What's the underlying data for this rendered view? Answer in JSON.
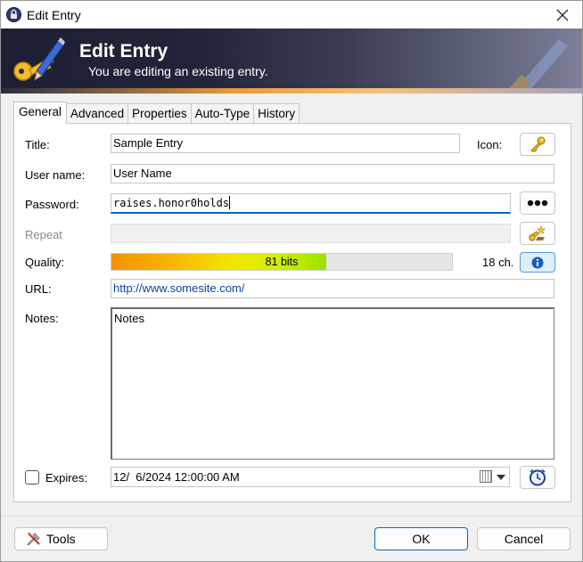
{
  "window": {
    "title": "Edit Entry",
    "close_label": "Close"
  },
  "banner": {
    "title": "Edit Entry",
    "subtitle": "You are editing an existing entry."
  },
  "tabs": [
    "General",
    "Advanced",
    "Properties",
    "Auto-Type",
    "History"
  ],
  "active_tab": "General",
  "form": {
    "title_label": "Title:",
    "title_value": "Sample Entry",
    "icon_label": "Icon:",
    "username_label": "User name:",
    "username_value": "User Name",
    "password_label": "Password:",
    "password_value": "raises.honor0holds",
    "repeat_label": "Repeat",
    "quality_label": "Quality:",
    "quality_text": "81 bits",
    "quality_fraction": 0.63,
    "quality_length": "18 ch.",
    "url_label": "URL:",
    "url_value": "http://www.somesite.com/",
    "notes_label": "Notes:",
    "notes_value": "Notes",
    "expires_label": "Expires:",
    "expires_checked": false,
    "expires_value": "12/  6/2024 12:00:00 AM"
  },
  "footer": {
    "tools_label": "Tools",
    "ok_label": "OK",
    "cancel_label": "Cancel"
  },
  "icons": {
    "app": "lock-icon",
    "banner": "key-pen-icon",
    "entry_icon": "key-icon",
    "show_password": "dots-icon",
    "generate": "password-generator-icon",
    "quality_info": "info-icon",
    "expiry_presets": "clock-icon",
    "tools": "tools-icon",
    "calendar": "calendar-icon",
    "dropdown": "chevron-down-icon"
  }
}
